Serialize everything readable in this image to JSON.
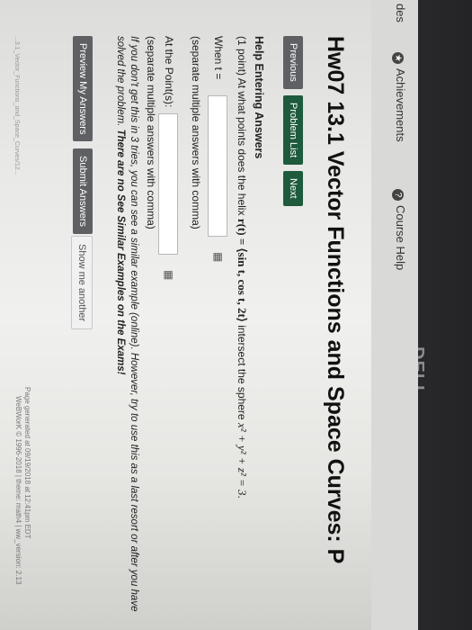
{
  "nav": {
    "left_partial": "des",
    "achievements": "Achievements",
    "course_help": "Course Help"
  },
  "page_title": "Hw07 13.1 Vector Functions and Space Curves: P",
  "buttons": {
    "previous": "Previous",
    "problem_list": "Problem List",
    "next": "Next"
  },
  "help_heading": "Help Entering Answers",
  "problem": {
    "points": "(1 point)",
    "question_start": "At what points does the helix",
    "helix": "r(t) = ⟨sin t, cos t, 2t⟩",
    "question_end": "intersect the sphere",
    "sphere": "x² + y² + z² = 3",
    "when_label": "When t =",
    "separate_note": "(separate multiple answers with comma)",
    "points_label": "At the Point(s):",
    "separate_note2": "(separate multiple answers with comma)"
  },
  "hint": {
    "line1": "If you don't get this in 3 tries, you can see a similar example (online). However, try to use this as a last resort or after you have",
    "line2a": "solved the problem.",
    "line2b": "There are no See Similar Examples on the Exams!"
  },
  "actions": {
    "preview": "Preview My Answers",
    "submit": "Submit Answers",
    "show_another": "Show me another"
  },
  "footer": {
    "generated": "Page generated at 09/19/2018 at 12:41pm EDT",
    "powered": "WeBWorK © 1996-2018 | theme: math4 | ww_version: 2.13"
  },
  "url_fragment": "...3.1_Vector_Functions_and_Space_Curves/12..."
}
